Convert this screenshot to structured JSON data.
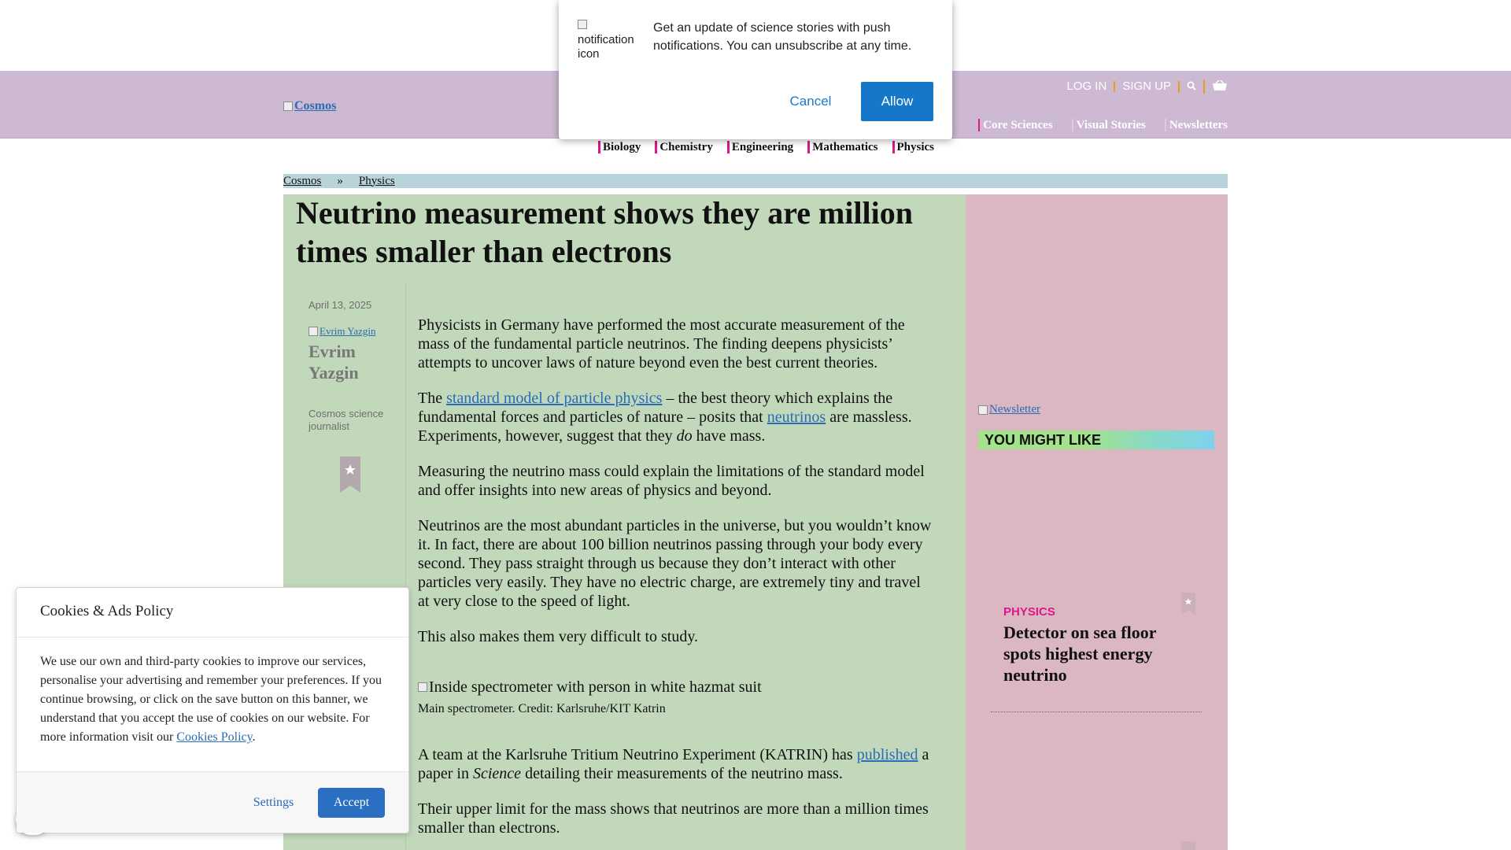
{
  "notification": {
    "icon_alt": "notification icon",
    "message": "Get an update of science stories with push notifications. You can unsubscribe at any time.",
    "cancel_label": "Cancel",
    "allow_label": "Allow"
  },
  "header": {
    "logo_alt": "Cosmos",
    "util_links": [
      "LOG IN",
      "SIGN UP"
    ],
    "search_icon": "search-icon",
    "cart_icon": "basket-icon",
    "main_nav": [
      ")",
      "Core Sciences",
      "Visual Stories",
      "Newsletters"
    ],
    "sub_nav": [
      "Biology",
      "Chemistry",
      "Engineering",
      "Mathematics",
      "Physics"
    ],
    "colors": {
      "header_bg": "#cdb9d1",
      "accent": "#e0168c"
    }
  },
  "breadcrumb": {
    "home": "Cosmos",
    "separator": "»",
    "section": "Physics"
  },
  "article": {
    "title": "Neutrino measurement shows they are million times smaller than electrons",
    "date": "April 13, 2025",
    "author_img_alt": "Evrim Yazgin",
    "author_name": "Evrim Yazgin",
    "author_role": "Cosmos science journalist",
    "p1": "Physicists in Germany have performed the most accurate measurement of the mass of the fundamental particle neutrinos. The finding deepens physicists’ attempts to uncover laws of nature beyond even the best current theories.",
    "p2_a": "The ",
    "p2_link1": "standard model of particle physics",
    "p2_b": " – the best theory which explains the fundamental forces and particles of nature – posits that ",
    "p2_link2": "neutrinos",
    "p2_c": " are massless. Experiments, however, suggest that they ",
    "p2_em": "do",
    "p2_d": " have mass.",
    "p3": "Measuring the neutrino mass could explain the limitations of the standard model and offer insights into new areas of physics and beyond.",
    "p4": "Neutrinos are the most abundant particles in the universe, but you wouldn’t know it. In fact, there are about 100 billion neutrinos passing through your body every second. They pass straight through us because they don’t interact with other particles very easily. They have no electric charge, are extremely tiny and travel at very close to the speed of light.",
    "p5": "This also makes them very difficult to study.",
    "figure_alt": "Inside spectrometer with person in white hazmat suit",
    "figure_caption": "Main spectrometer. Credit: Karlsruhe/KIT Katrin",
    "p6_a": "A team at the Karlsruhe Tritium Neutrino Experiment (KATRIN) has ",
    "p6_link": "published",
    "p6_b": " a paper in ",
    "p6_em": "Science",
    "p6_c": " detailing their measurements of the neutrino mass.",
    "p7": "Their upper limit for the mass shows that neutrinos are more than a million times smaller than electrons."
  },
  "sidebar": {
    "newsletter_alt": "Newsletter",
    "you_might_like": "YOU MIGHT LIKE",
    "card": {
      "category": "PHYSICS",
      "title": "Detector on sea floor spots highest energy neutrino"
    }
  },
  "cookies": {
    "title": "Cookies & Ads Policy",
    "text": "We use our own and third-party cookies to improve our services, personalise your advertising and remember your preferences. If you continue browsing, or click on the save button on this banner, we understand that you accept the use of cookies on our website. For more information visit our ",
    "link": "Cookies Policy",
    "text_end": ".",
    "settings_label": "Settings",
    "accept_label": "Accept"
  }
}
